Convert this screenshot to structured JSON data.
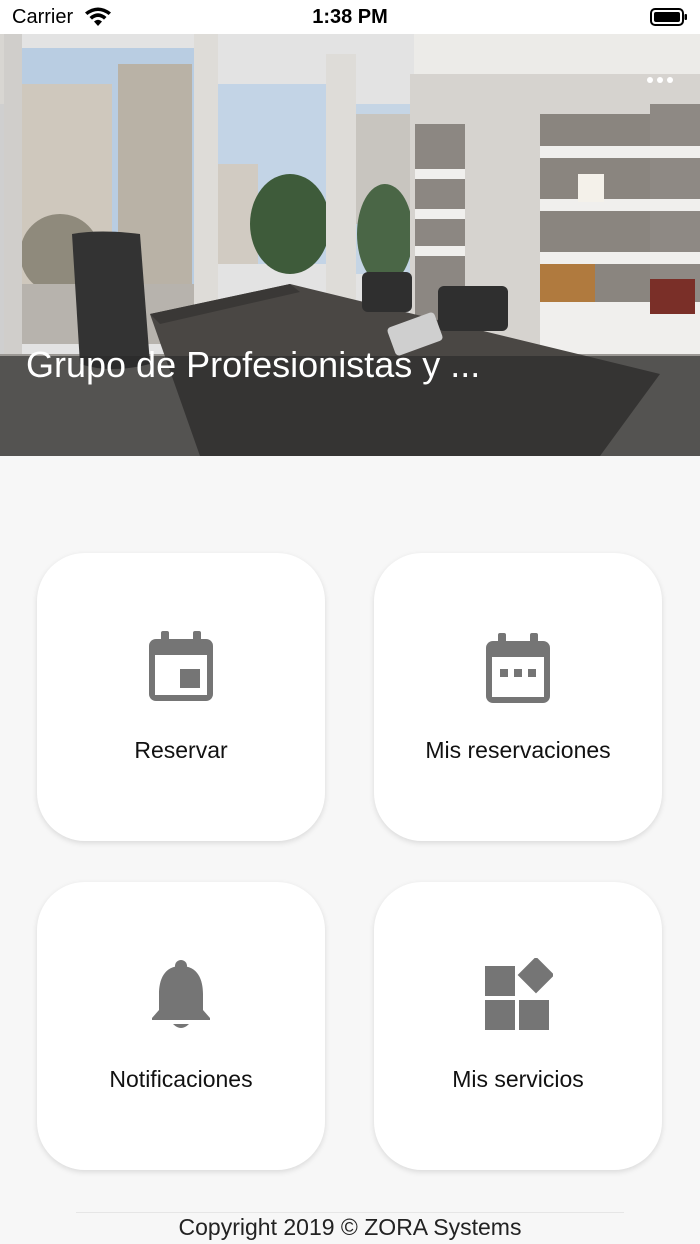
{
  "status_bar": {
    "carrier": "Carrier",
    "time": "1:38 PM",
    "wifi_icon": "wifi-icon",
    "battery_icon": "battery-icon"
  },
  "hero": {
    "title": "Grupo de Profesionistas y ...",
    "more_icon": "more-horizontal-icon",
    "image": "office-photo"
  },
  "tiles": [
    {
      "label": "Reservar",
      "icon": "calendar-day-icon"
    },
    {
      "label": "Mis reservaciones",
      "icon": "calendar-dots-icon"
    },
    {
      "label": "Notificaciones",
      "icon": "bell-icon"
    },
    {
      "label": "Mis servicios",
      "icon": "widgets-icon"
    }
  ],
  "footer": {
    "copyright": "Copyright 2019 © ZORA Systems"
  },
  "colors": {
    "icon": "#757575",
    "tile_bg": "#ffffff",
    "page_bg": "#f7f7f7",
    "overlay": "#3a3a3a"
  }
}
